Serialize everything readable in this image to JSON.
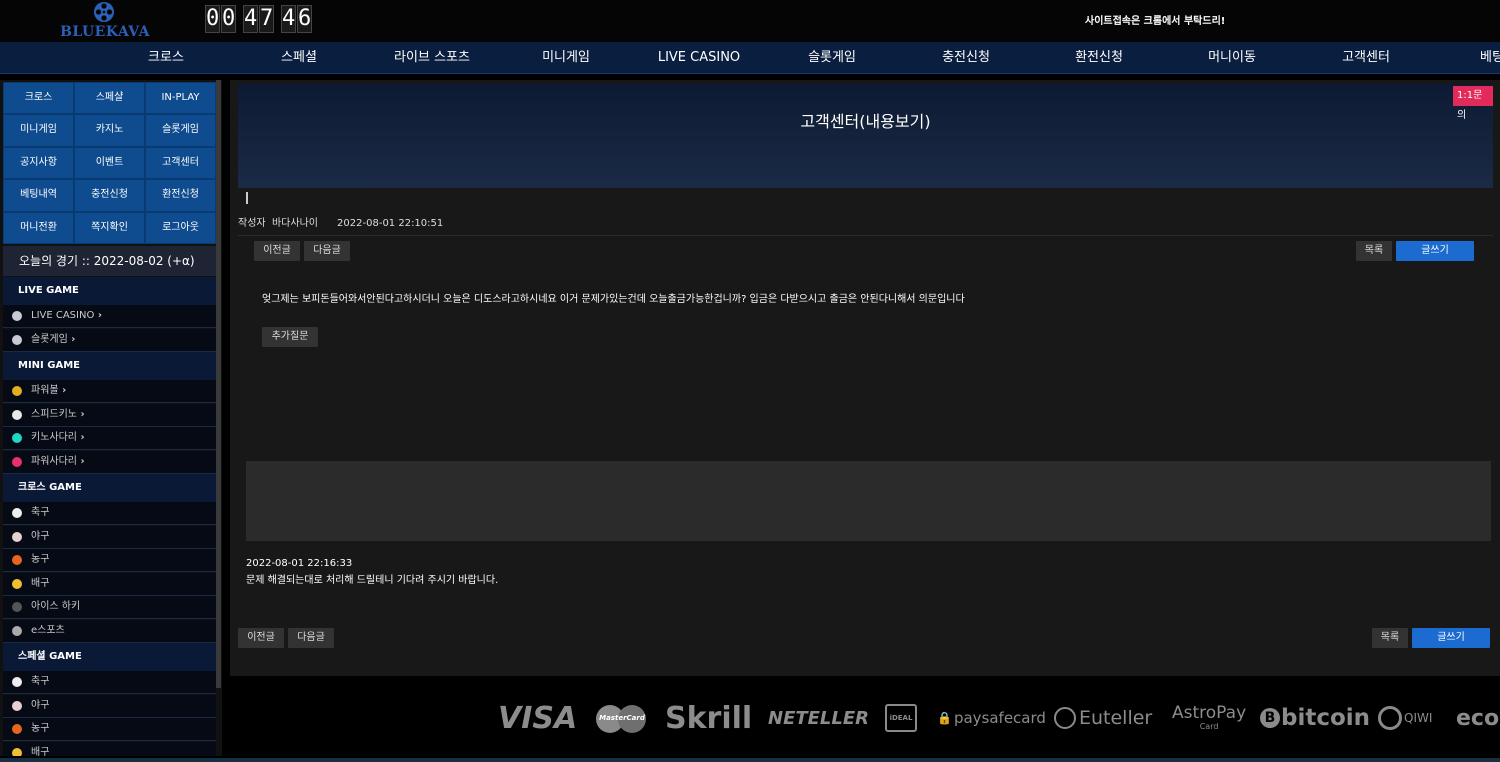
{
  "header": {
    "logo_text": "BLUEKAVA",
    "timer": {
      "h": "00",
      "m": "47",
      "s": "46"
    },
    "notice": "사이트접속은 크롬에서 부탁드리!"
  },
  "nav": [
    "크로스",
    "스페셜",
    "라이브 스포츠",
    "미니게임",
    "LIVE CASINO",
    "슬롯게임",
    "충전신청",
    "환전신청",
    "머니이동",
    "고객센터",
    "베팅"
  ],
  "sidebar": {
    "grid": [
      "크로스",
      "스페샬",
      "IN-PLAY",
      "미니게임",
      "카지노",
      "슬롯게임",
      "공지사항",
      "이벤트",
      "고객센터",
      "베팅내역",
      "충전신청",
      "환전신청",
      "머니전환",
      "쪽지확인",
      "로그아웃"
    ],
    "today": "오늘의 경기 :: 2022-08-02 (+α)",
    "sections": [
      {
        "title": "LIVE GAME",
        "items": [
          {
            "label": "LIVE CASINO",
            "icon": "casino-icon",
            "color": "#c9c9d9"
          },
          {
            "label": "슬롯게임",
            "icon": "slot-icon",
            "color": "#c9c9d9"
          }
        ]
      },
      {
        "title": "MINI GAME",
        "items": [
          {
            "label": "파워볼",
            "icon": "powerball-icon",
            "color": "#e0b020"
          },
          {
            "label": "스피드키노",
            "icon": "speedkeno-icon",
            "color": "#e8e8e8"
          },
          {
            "label": "키노사다리",
            "icon": "kenoladder-icon",
            "color": "#20d8c0"
          },
          {
            "label": "파워사다리",
            "icon": "powerladder-icon",
            "color": "#e8306a"
          }
        ]
      },
      {
        "title": "크로스 GAME",
        "items": [
          {
            "label": "축구",
            "icon": "soccer-icon",
            "color": "#eeeeee"
          },
          {
            "label": "야구",
            "icon": "baseball-icon",
            "color": "#e6d0d0"
          },
          {
            "label": "농구",
            "icon": "basketball-icon",
            "color": "#e5661f"
          },
          {
            "label": "배구",
            "icon": "volleyball-icon",
            "color": "#f0c030"
          },
          {
            "label": "아이스 하키",
            "icon": "hockey-icon",
            "color": "#555555"
          },
          {
            "label": "e스포츠",
            "icon": "esports-icon",
            "color": "#aaaaaa"
          }
        ]
      },
      {
        "title": "스페셜 GAME",
        "items": [
          {
            "label": "축구",
            "icon": "soccer-icon",
            "color": "#eeeeee"
          },
          {
            "label": "야구",
            "icon": "baseball-icon",
            "color": "#e6d0d0"
          },
          {
            "label": "농구",
            "icon": "basketball-icon",
            "color": "#e5661f"
          },
          {
            "label": "배구",
            "icon": "volleyball-icon",
            "color": "#f0c030"
          }
        ]
      }
    ]
  },
  "post": {
    "title": "고객센터(내용보기)",
    "badge": "1:1문의",
    "author_label": "작성자",
    "author": "바다사나이",
    "date": "2022-08-01 22:10:51",
    "prev_label": "이전글",
    "next_label": "다음글",
    "list_label": "목록",
    "write_label": "글쓰기",
    "content": "엊그제는 보피돈들어와서안된다고하시더니 오늘은 디도스라고하시네요 이거 문제가있는건데 오늘출금가능한겁니까? 입금은 다받으시고 출금은 안된다니해서 의문입니다",
    "more_question_label": "추가질문",
    "reply_date": "2022-08-01 22:16:33",
    "reply_text": "문제 해결되는대로 처리해 드릴테니 기다려 주시기 바랍니다."
  },
  "payments": [
    "VISA",
    "MasterCard",
    "Skrill",
    "NETELLER",
    "iDEAL",
    "paysafecard",
    "Euteller",
    "AstroPay",
    "Card",
    "bitcoin",
    "QIWI",
    "eco"
  ]
}
